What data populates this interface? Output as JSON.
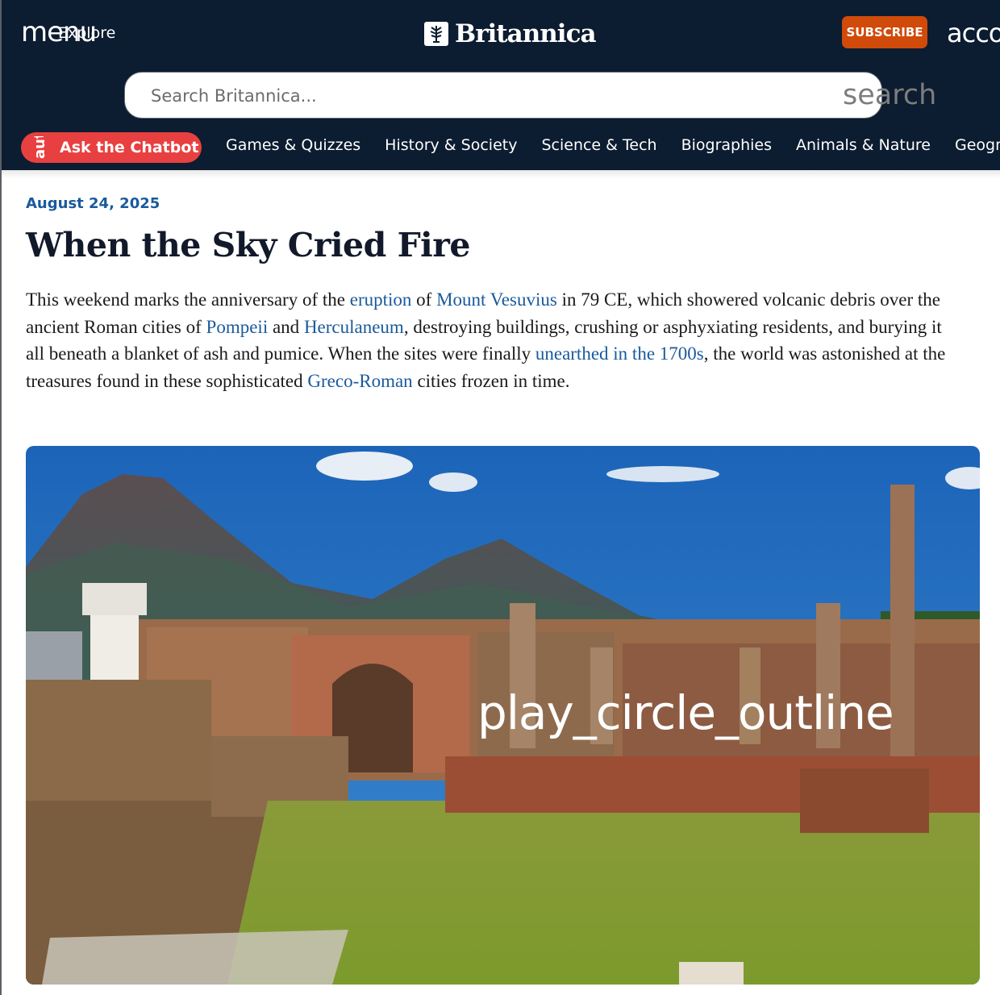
{
  "header": {
    "menu_icon_text": "menu",
    "menu_label": "Explore",
    "logo_text": "Britannica",
    "subscribe_label": "SUBSCRIBE",
    "account_icon_text": "account_circle"
  },
  "search": {
    "placeholder": "Search Britannica...",
    "icon_text": "search"
  },
  "chatbot": {
    "icon_text": "auto_awesome",
    "label": "Ask the Chatbot"
  },
  "nav": {
    "items": [
      "Games & Quizzes",
      "History & Society",
      "Science & Tech",
      "Biographies",
      "Animals & Nature",
      "Geography & Travel"
    ]
  },
  "article": {
    "date": "August 24, 2025",
    "title": "When the Sky Cried Fire",
    "p1": "This weekend marks the anniversary of the ",
    "link_eruption": "eruption",
    "p2": " of ",
    "link_vesuvius": "Mount Vesuvius",
    "p3": " in 79 CE, which showered volcanic debris over the ancient Roman cities of ",
    "link_pompeii": "Pompeii",
    "p4": " and ",
    "link_herculaneum": "Herculaneum",
    "p5": ", destroying buildings, crushing or asphyxiating residents, and burying it all beneath a blanket of ash and pumice. When the sites were finally ",
    "link_unearthed": "unearthed in the 1700s",
    "p6": ", the world was astonished at the treasures found in these sophisticated ",
    "link_greco": "Greco-Roman",
    "p7": " cities frozen in time."
  },
  "media": {
    "play_icon_text": "play_circle_outline"
  },
  "colors": {
    "header_bg": "#0c1c31",
    "subscribe_bg": "#d04a0a",
    "chatbot_bg": "#e84040",
    "link": "#1a5a9c"
  }
}
